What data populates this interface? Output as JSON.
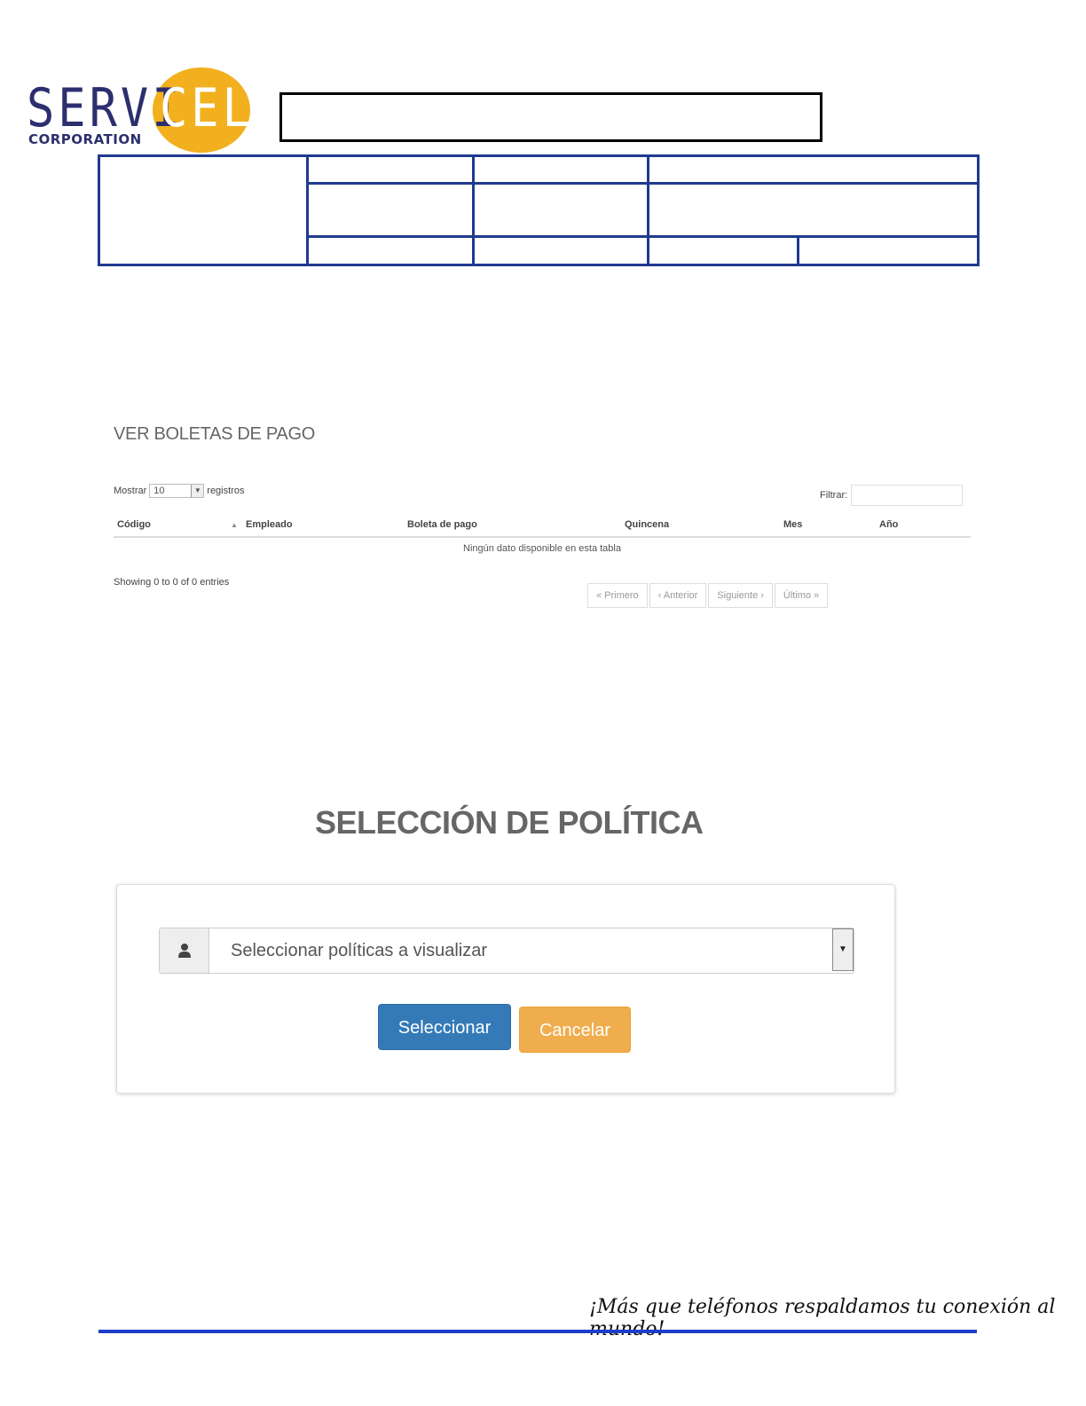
{
  "logo": {
    "part1": "SERVI",
    "part2": "CEL",
    "corporation": "CORPORATION"
  },
  "boletas": {
    "title": "VER BOLETAS DE PAGO",
    "show_label": "Mostrar",
    "show_value": "10",
    "records_label": "registros",
    "filter_label": "Filtrar:",
    "columns": [
      "Código",
      "Empleado",
      "Boleta de pago",
      "Quincena",
      "Mes",
      "Año"
    ],
    "empty_message": "Ningún dato disponible en esta tabla",
    "info": "Showing 0 to 0 of 0 entries",
    "pager": {
      "first": "« Primero",
      "prev": "‹ Anterior",
      "next": "Siguiente ›",
      "last": "Último »"
    }
  },
  "politica": {
    "title": "SELECCIÓN DE POLÍTICA",
    "select_placeholder": "Seleccionar políticas a visualizar",
    "select_button": "Seleccionar",
    "cancel_button": "Cancelar"
  },
  "footer": {
    "slogan": "¡Más que teléfonos respaldamos tu conexión al mundo!"
  },
  "colors": {
    "brand_blue": "#1f3a8f",
    "logo_yellow": "#f2b01e",
    "primary": "#337ab7",
    "warning": "#f0ad4e"
  }
}
